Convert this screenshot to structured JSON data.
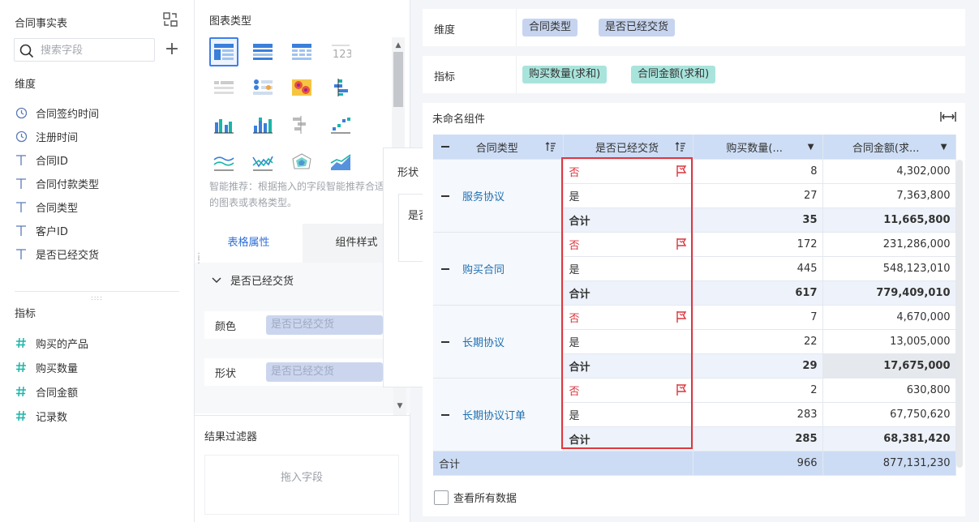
{
  "dataset": {
    "title": "合同事实表"
  },
  "search": {
    "placeholder": "搜索字段"
  },
  "dimensions": {
    "label": "维度",
    "items": [
      {
        "name": "合同签约时间",
        "icon": "clock-icon"
      },
      {
        "name": "注册时间",
        "icon": "clock-icon"
      },
      {
        "name": "合同ID",
        "icon": "text-type-icon"
      },
      {
        "name": "合同付款类型",
        "icon": "text-type-icon"
      },
      {
        "name": "合同类型",
        "icon": "text-type-icon"
      },
      {
        "name": "客户ID",
        "icon": "text-type-icon"
      },
      {
        "name": "是否已经交货",
        "icon": "text-type-icon"
      }
    ]
  },
  "metrics": {
    "label": "指标",
    "items": [
      {
        "name": "购买的产品",
        "icon": "hash-icon"
      },
      {
        "name": "购买数量",
        "icon": "hash-icon"
      },
      {
        "name": "合同金额",
        "icon": "hash-icon"
      },
      {
        "name": "记录数",
        "icon": "hash-icon"
      }
    ]
  },
  "chart_types": {
    "title": "图表类型",
    "tip": "智能推荐：根据拖入的字段智能推荐合适的图表或表格类型。"
  },
  "tabs": {
    "table_props": "表格属性",
    "widget_style": "组件样式"
  },
  "props": {
    "section": "是否已经交货",
    "color_label": "颜色",
    "color_field": "是否已经交货",
    "shape_label": "形状",
    "shape_field": "是否已经交货"
  },
  "filter": {
    "title": "结果过滤器",
    "drop_hint": "拖入字段"
  },
  "popover": {
    "title": "形状",
    "content": "是否"
  },
  "bars": {
    "dim_label": "维度",
    "dim_chips": [
      "合同类型",
      "是否已经交货"
    ],
    "met_label": "指标",
    "met_chips": [
      "购买数量(求和)",
      "合同金额(求和)"
    ]
  },
  "widget": {
    "title": "未命名组件"
  },
  "table": {
    "headers": [
      "合同类型",
      "是否已经交货",
      "购买数量(...",
      "合同金额(求..."
    ],
    "groups": [
      {
        "name": "服务协议",
        "rows": [
          {
            "label": "否",
            "qty": "8",
            "amt": "4,302,000"
          },
          {
            "label": "是",
            "qty": "27",
            "amt": "7,363,800"
          },
          {
            "label": "合计",
            "qty": "35",
            "amt": "11,665,800"
          }
        ]
      },
      {
        "name": "购买合同",
        "rows": [
          {
            "label": "否",
            "qty": "172",
            "amt": "231,286,000"
          },
          {
            "label": "是",
            "qty": "445",
            "amt": "548,123,010"
          },
          {
            "label": "合计",
            "qty": "617",
            "amt": "779,409,010"
          }
        ]
      },
      {
        "name": "长期协议",
        "rows": [
          {
            "label": "否",
            "qty": "7",
            "amt": "4,670,000"
          },
          {
            "label": "是",
            "qty": "22",
            "amt": "13,005,000"
          },
          {
            "label": "合计",
            "qty": "29",
            "amt": "17,675,000"
          }
        ]
      },
      {
        "name": "长期协议订单",
        "rows": [
          {
            "label": "否",
            "qty": "2",
            "amt": "630,800"
          },
          {
            "label": "是",
            "qty": "283",
            "amt": "67,750,620"
          },
          {
            "label": "合计",
            "qty": "285",
            "amt": "68,381,420"
          }
        ]
      }
    ],
    "total": {
      "label": "合计",
      "qty": "966",
      "amt": "877,131,230"
    }
  },
  "footer": {
    "check_all": "查看所有数据"
  },
  "colors": {
    "accent": "#2f6fd6",
    "flag": "#d9363e",
    "dim_chip": "#c6d4ef",
    "met_chip": "#a9e4dc"
  }
}
